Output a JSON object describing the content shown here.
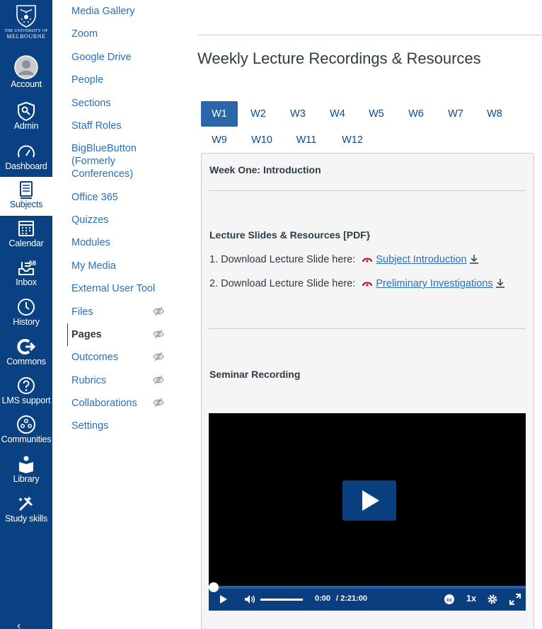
{
  "logo": {
    "line1": "THE UNIVERSITY OF",
    "line2": "MELBOURNE"
  },
  "global_nav": {
    "account": "Account",
    "admin": "Admin",
    "dashboard": "Dashboard",
    "subjects": "Subjects",
    "calendar": "Calendar",
    "inbox": "Inbox",
    "inbox_count": "58",
    "history": "History",
    "commons": "Commons",
    "lms_support": "LMS support",
    "communities": "Communities",
    "library": "Library",
    "study_skills": "Study skills"
  },
  "course_nav": {
    "media_gallery": "Media Gallery",
    "zoom": "Zoom",
    "google_drive": "Google Drive",
    "people": "People",
    "sections": "Sections",
    "staff_roles": "Staff Roles",
    "bigbluebutton_1": "BigBlueButton",
    "bigbluebutton_2": "(Formerly",
    "bigbluebutton_3": "Conferences)",
    "office_365": "Office 365",
    "quizzes": "Quizzes",
    "modules": "Modules",
    "my_media": "My Media",
    "external_user_tool": "External User Tool",
    "files": "Files",
    "pages": "Pages",
    "outcomes": "Outcomes",
    "rubrics": "Rubrics",
    "collaborations": "Collaborations",
    "settings": "Settings"
  },
  "page": {
    "title": "Weekly Lecture Recordings & Resources"
  },
  "tabs": [
    "W1",
    "W2",
    "W3",
    "W4",
    "W5",
    "W6",
    "W7",
    "W8",
    "W9",
    "W10",
    "W11",
    "W12"
  ],
  "active_tab": "W1",
  "content": {
    "week_heading": "Week One: Introduction",
    "slides_heading": "Lecture Slides & Resources [PDF}",
    "download_1_prefix": "1. Download Lecture Slide here:",
    "download_1_link": "Subject Introduction",
    "download_2_prefix": "2. Download Lecture Slide here:",
    "download_2_link": "Preliminary Investigations",
    "seminar_heading": "Seminar Recording"
  },
  "video": {
    "current_time": "0:00",
    "duration": "/ 2:21:00",
    "playback_rate": "1x",
    "progress": 0
  },
  "colors": {
    "nav_bg": "#094183",
    "link": "#2b6fb8",
    "tab_active": "#2b67a8",
    "video_controls": "#0b3e7e"
  }
}
